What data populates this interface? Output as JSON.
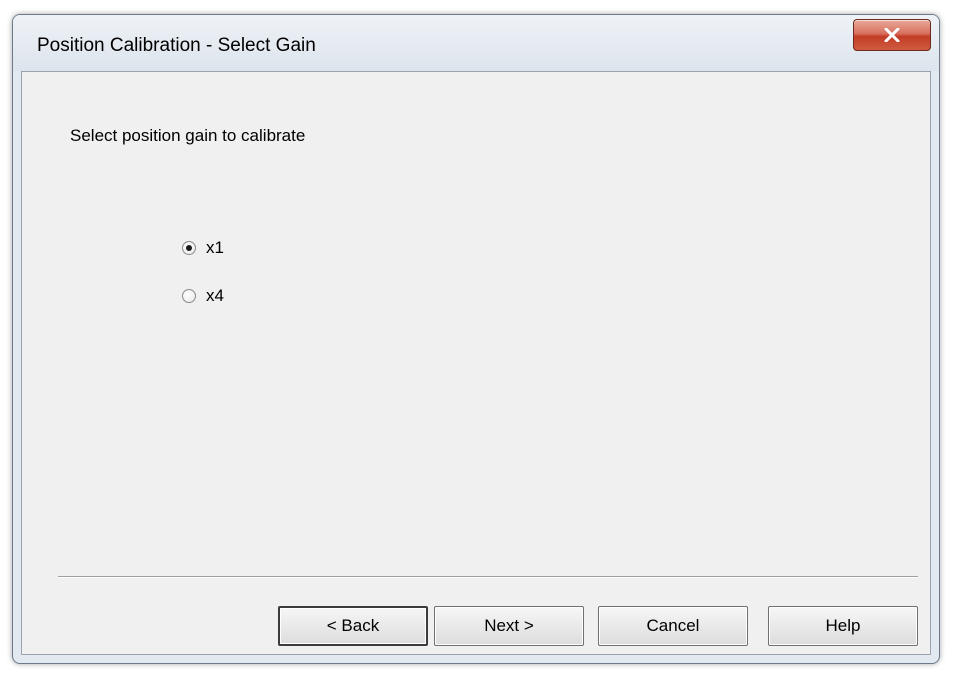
{
  "window": {
    "title": "Position Calibration - Select Gain",
    "close_icon": "close-x-icon"
  },
  "content": {
    "instruction": "Select position gain to calibrate",
    "gain_options": [
      {
        "label": "x1",
        "selected": true
      },
      {
        "label": "x4",
        "selected": false
      }
    ]
  },
  "buttons": {
    "back": "< Back",
    "next": "Next >",
    "cancel": "Cancel",
    "help": "Help"
  },
  "colors": {
    "close_button": "#c94a34",
    "dialog_background": "#f0f0f0"
  }
}
